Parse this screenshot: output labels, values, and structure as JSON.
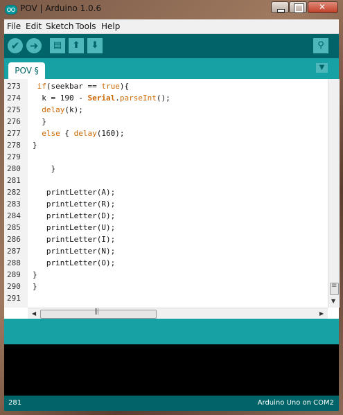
{
  "window": {
    "title": "POV | Arduino 1.0.6"
  },
  "menu": {
    "items": [
      "File",
      "Edit",
      "Sketch",
      "Tools",
      "Help"
    ]
  },
  "toolbar": {
    "verify_icon": "check-icon",
    "upload_icon": "arrow-right-icon",
    "new_icon": "document-icon",
    "open_icon": "arrow-up-icon",
    "save_icon": "arrow-down-icon",
    "serial_monitor_icon": "magnifier-icon"
  },
  "tabs": {
    "active": "POV §"
  },
  "editor": {
    "lines": [
      {
        "num": "273",
        "code": " if(seekbar == true){"
      },
      {
        "num": "274",
        "code": "  k = 190 - Serial.parseInt();"
      },
      {
        "num": "275",
        "code": "  delay(k);"
      },
      {
        "num": "276",
        "code": "  }"
      },
      {
        "num": "277",
        "code": "  else { delay(160);"
      },
      {
        "num": "278",
        "code": "}"
      },
      {
        "num": "279",
        "code": ""
      },
      {
        "num": "280",
        "code": "    }"
      },
      {
        "num": "281",
        "code": ""
      },
      {
        "num": "282",
        "code": "   printLetter(A);"
      },
      {
        "num": "283",
        "code": "   printLetter(R);"
      },
      {
        "num": "284",
        "code": "   printLetter(D);"
      },
      {
        "num": "285",
        "code": "   printLetter(U);"
      },
      {
        "num": "286",
        "code": "   printLetter(I);"
      },
      {
        "num": "287",
        "code": "   printLetter(N);"
      },
      {
        "num": "288",
        "code": "   printLetter(O);"
      },
      {
        "num": "289",
        "code": "}"
      },
      {
        "num": "290",
        "code": "}"
      },
      {
        "num": "291",
        "code": ""
      }
    ]
  },
  "status": {
    "line": "281",
    "board": "Arduino Uno on COM2"
  },
  "colors": {
    "teal": "#00979c",
    "dark_teal": "#006468",
    "keyword": "#cc6600"
  }
}
